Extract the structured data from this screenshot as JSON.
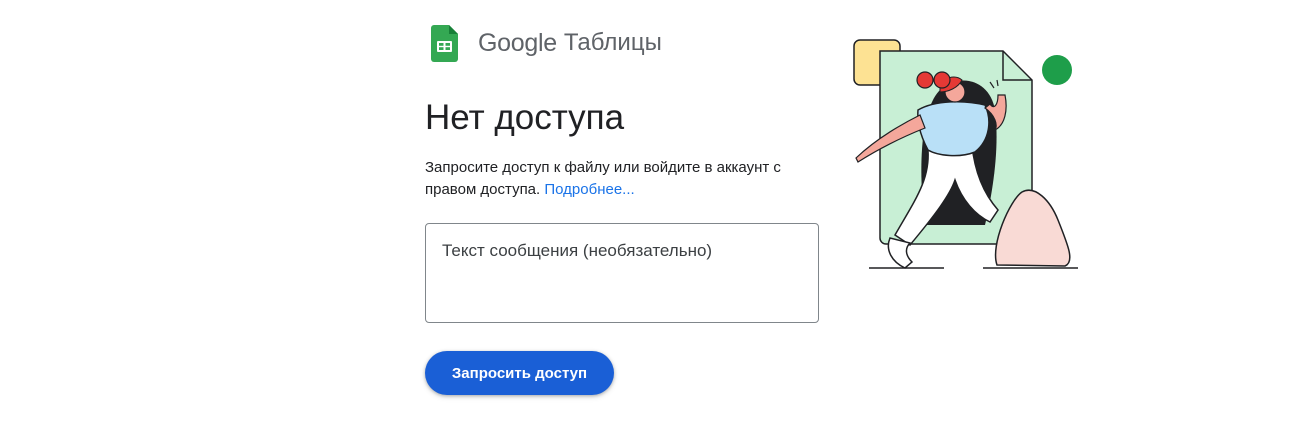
{
  "brand": {
    "google": "Google",
    "product": "Таблицы",
    "logo_icon": "google-sheets-icon",
    "logo_color": "#34a853"
  },
  "main": {
    "title": "Нет доступа",
    "description": "Запросите доступ к файлу или войдите в аккаунт с правом доступа.",
    "learn_more": "Подробнее...",
    "message_placeholder": "Текст сообщения (необязательно)",
    "message_value": "",
    "request_button": "Запросить доступ"
  },
  "colors": {
    "accent": "#1a73e8",
    "button": "#1a5fd6",
    "illustration_green": "#c8efd5",
    "illustration_dot": "#1e9e4a",
    "illustration_yellow": "#fde293",
    "illustration_pink": "#f9dad5",
    "illustration_red": "#e53935"
  }
}
